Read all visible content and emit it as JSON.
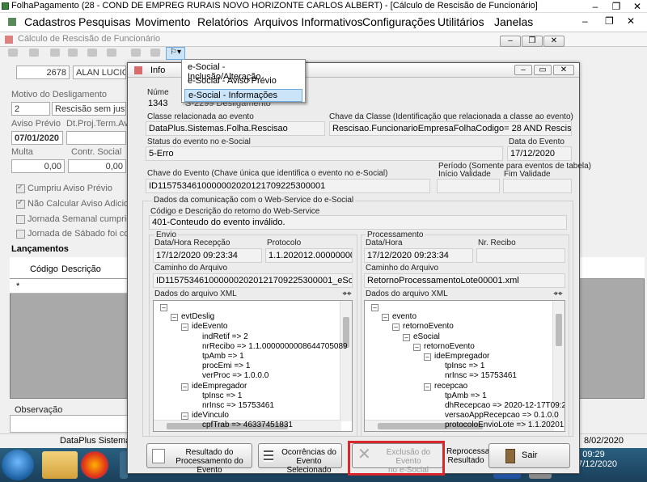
{
  "window": {
    "title": "FolhaPagamento (28 - COND DE EMPREG RURAIS NOVO HORIZONTE CARLOS ALBERT) - [Cálculo de Rescisão de Funcionário]",
    "minimize": "–",
    "restore": "❐",
    "close": "✕"
  },
  "menu": [
    "Cadastros",
    "Pesquisas",
    "Movimento",
    "Relatórios",
    "Arquivos Informativos",
    "Configurações",
    "Utilitários",
    "Janelas"
  ],
  "background_form": {
    "title": "Cálculo de Rescisão de Funcionário",
    "employee_code": "2678",
    "employee_name": "ALAN LUCIO",
    "motivo_label": "Motivo do Desligamento",
    "motivo_code": "2",
    "motivo_text": "Rescisão sem just",
    "aviso_label": "Aviso Prévio",
    "dt_proj_label": "Dt.Proj.Term.Av",
    "aviso_value": "07/01/2020",
    "multa_label": "Multa",
    "contr_label": "Contr. Social",
    "multa_value": "0,00",
    "contr_value": "0,00",
    "chk_cumpriu": "Cumpriu Aviso Prévio",
    "chk_nao_calcular": "Não Calcular Aviso Adicion",
    "chk_jornada_semanal": "Jornada Semanal cumprid",
    "chk_jornada_sabado": "Jornada de Sábado foi con",
    "lancamentos": "Lançamentos",
    "col_codigo": "Código",
    "col_descricao": "Descrição",
    "row_marker": "*",
    "observacao": "Observação",
    "status_left": "DataPlus Sistemas",
    "status_right": "8/02/2020"
  },
  "dropdown": {
    "items": [
      "e-Social - Inclusão/Alteração",
      "e-Social - Aviso Prévio",
      "e-Social - Informações"
    ],
    "selected_index": 2
  },
  "dialog": {
    "title": "Info",
    "numero_label": "Núme",
    "numero_value": "1343",
    "evento_partial": "S-2299 Desligamento",
    "classe_label": "Classe relacionada ao evento",
    "classe_value": "DataPlus.Sistemas.Folha.Rescisao",
    "chave_classe_label": "Chave da Classe (Identificação que relacionada a classe ao evento)",
    "chave_classe_value": "Rescisao.FuncionarioEmpresaFolhaCodigo= 28  AND Rescisao",
    "status_label": "Status do evento no e-Social",
    "status_value": "5-Erro",
    "data_evento_label": "Data do Evento",
    "data_evento_value": "17/12/2020",
    "chave_evento_label": "Chave do Evento (Chave única que identifica o evento no e-Social)",
    "chave_evento_value": "ID1157534610000002020121709225300001",
    "periodo_label": "Período (Somente para eventos de tabela)",
    "inicio_label": "Início Validade",
    "fim_label": "Fim Validade",
    "comunicacao_label": "Dados da comunicação com o Web-Service do e-Social",
    "retorno_label": "Código e Descrição do retorno do Web-Service",
    "retorno_value": "401-Conteudo do evento inválido.",
    "envio": {
      "label": "Envio",
      "datahora_label": "Data/Hora Recepção",
      "datahora_value": "17/12/2020 09:23:34",
      "protocolo_label": "Protocolo",
      "protocolo_value": "1.1.202012.0000000001",
      "caminho_label": "Caminho do Arquivo",
      "caminho_value": "ID1157534610000002020121709225300001_eSocial_e",
      "xml_label": "Dados do arquivo XML",
      "tree": [
        {
          "t": "",
          "lvl": 0,
          "box": "–"
        },
        {
          "t": "evtDeslig",
          "lvl": 1,
          "box": "–"
        },
        {
          "t": "ideEvento",
          "lvl": 2,
          "box": "–"
        },
        {
          "t": "indRetif => 2",
          "lvl": 3,
          "box": ""
        },
        {
          "t": "nrRecibo => 1.1.0000000008644705089",
          "lvl": 3,
          "box": ""
        },
        {
          "t": "tpAmb => 1",
          "lvl": 3,
          "box": ""
        },
        {
          "t": "procEmi => 1",
          "lvl": 3,
          "box": ""
        },
        {
          "t": "verProc => 1.0.0.0",
          "lvl": 3,
          "box": ""
        },
        {
          "t": "ideEmpregador",
          "lvl": 2,
          "box": "–"
        },
        {
          "t": "tpInsc => 1",
          "lvl": 3,
          "box": ""
        },
        {
          "t": "nrInsc => 15753461",
          "lvl": 3,
          "box": ""
        },
        {
          "t": "ideVinculo",
          "lvl": 2,
          "box": "–"
        },
        {
          "t": "cpfTrab => 46337451831",
          "lvl": 3,
          "box": ""
        }
      ]
    },
    "processamento": {
      "label": "Processamento",
      "datahora_label": "Data/Hora",
      "datahora_value": "17/12/2020 09:23:34",
      "recibo_label": "Nr. Recibo",
      "recibo_value": "",
      "caminho_label": "Caminho do Arquivo",
      "caminho_value": "RetornoProcessamentoLote00001.xml",
      "xml_label": "Dados do arquivo XML",
      "tree": [
        {
          "t": "",
          "lvl": 0,
          "box": "–"
        },
        {
          "t": "evento",
          "lvl": 1,
          "box": "–"
        },
        {
          "t": "retornoEvento",
          "lvl": 2,
          "box": "–"
        },
        {
          "t": "eSocial",
          "lvl": 3,
          "box": "–"
        },
        {
          "t": "retornoEvento",
          "lvl": 4,
          "box": "–"
        },
        {
          "t": "ideEmpregador",
          "lvl": 5,
          "box": "–"
        },
        {
          "t": "tpInsc => 1",
          "lvl": 6,
          "box": ""
        },
        {
          "t": "nrInsc => 15753461",
          "lvl": 6,
          "box": ""
        },
        {
          "t": "recepcao",
          "lvl": 5,
          "box": "–"
        },
        {
          "t": "tpAmb => 1",
          "lvl": 6,
          "box": ""
        },
        {
          "t": "dhRecepcao => 2020-12-17T09:23",
          "lvl": 6,
          "box": ""
        },
        {
          "t": "versaoAppRecepcao => 0.1.0.0",
          "lvl": 6,
          "box": ""
        },
        {
          "t": "protocoloEnvioLote => 1.1.202012",
          "lvl": 6,
          "box": ""
        }
      ]
    },
    "buttons": {
      "resultado": "Resultado do\nProcessamento do Evento",
      "ocorrencias": "Ocorrências do\nEvento Selecionado",
      "exclusao": "Exclusão do Evento\nno e-Social",
      "reprocessa": "Reprocessa\nResultado",
      "sair": "Sair"
    }
  },
  "taskbar": {
    "time": "09:29",
    "date": "17/12/2020"
  },
  "colors": {
    "highlight": "#cce4f7",
    "highlight_border": "#6fa8dc",
    "red_box": "#d9272e",
    "taskbar": "#1f4a68"
  }
}
